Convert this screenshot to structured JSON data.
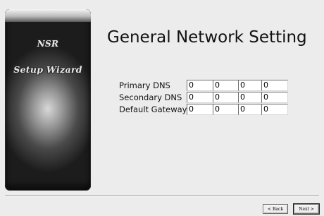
{
  "banner": {
    "line1": "NSR",
    "line2": "Setup Wizard"
  },
  "page": {
    "title": "General Network Setting"
  },
  "fields": [
    {
      "label": "Primary DNS",
      "octets": [
        "0",
        "0",
        "0",
        "0"
      ]
    },
    {
      "label": "Secondary DNS",
      "octets": [
        "0",
        "0",
        "0",
        "0"
      ]
    },
    {
      "label": "Default Gateway",
      "octets": [
        "0",
        "0",
        "0",
        "0"
      ]
    }
  ],
  "buttons": {
    "back_label": "< Back",
    "next_label": "Next >"
  }
}
